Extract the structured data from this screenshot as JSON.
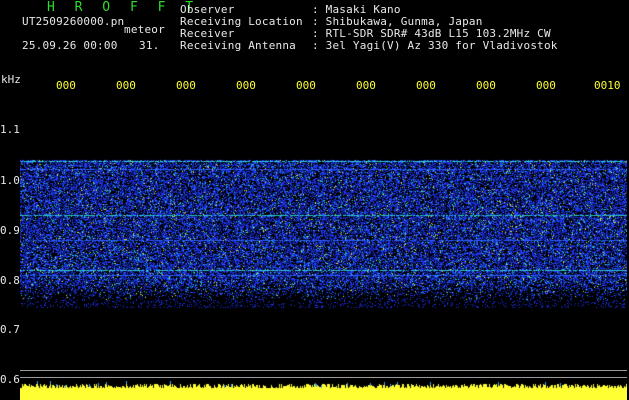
{
  "header": {
    "app_title": "H R O F F T",
    "filename": "UT2509260000.pn",
    "mode": "meteor",
    "date_time": "25.09.26 00:00",
    "count": "31.",
    "fields": [
      {
        "label": "Observer",
        "value": ": Masaki Kano"
      },
      {
        "label": "Receiving Location",
        "value": ": Shibukawa, Gunma, Japan"
      },
      {
        "label": "Receiver",
        "value": ": RTL-SDR SDR# 43dB L15 103.2MHz CW"
      },
      {
        "label": "Receiving Antenna",
        "value": ": 3el Yagi(V) Az 330 for Vladivostok"
      }
    ]
  },
  "axes": {
    "y_unit": "kHz",
    "y_ticks": [
      "1.1",
      "1.0",
      "0.9",
      "0.8",
      "0.7",
      "0.6"
    ],
    "x_ticks": [
      "000",
      "000",
      "000",
      "000",
      "000",
      "000",
      "000",
      "000",
      "000",
      "0010"
    ]
  },
  "colors": {
    "background": "#000000",
    "title_green": "#2fdc2f",
    "label_white": "#e8e8e8",
    "tick_yellow": "#ffff33",
    "signal_blue": "#1a3cff",
    "signal_cyan": "#22d6d6",
    "signal_yellow": "#ffff33"
  }
}
